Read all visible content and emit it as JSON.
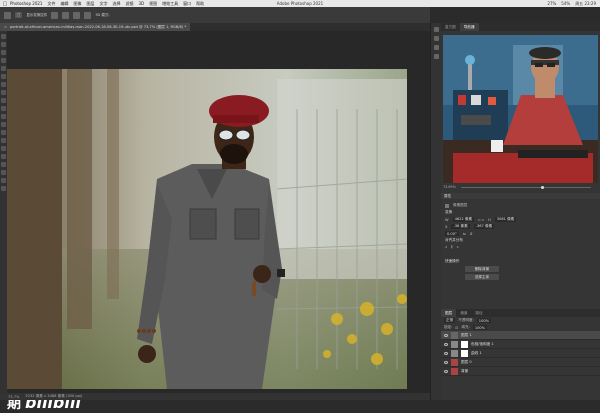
{
  "menubar": {
    "apple": "",
    "items": [
      "Photoshop 2021",
      "文件",
      "编辑",
      "图像",
      "图层",
      "文字",
      "选择",
      "滤镜",
      "3D",
      "视图",
      "增效工具",
      "窗口",
      "帮助"
    ],
    "app_title": "Adobe Photoshop 2021",
    "status": [
      "27%",
      "54%",
      "周五 23:29"
    ]
  },
  "options": {
    "btn1": "□",
    "label1": "显示变换控件",
    "label2": "3D 模式:"
  },
  "document_tab": {
    "close": "×",
    "title": "portrait-of-african-american-militias-man-2022-06-18-06-30-19-utc.psd @ 73.7% (图层 1, RGB/8) *"
  },
  "status_bar": {
    "zoom": "73.7%",
    "info": "5232 像素 x 3488 像素 (300 ppi)"
  },
  "watermark": {
    "prefix": "期",
    "logo": "bilibili"
  },
  "right_panel": {
    "tabs": [
      "图层",
      "通道",
      "路径"
    ],
    "top_tabs": [
      "直方图",
      "导航器"
    ],
    "zoom": "73.69%",
    "properties": {
      "header": "属性",
      "kind": "像素图层",
      "transform_title": "变换",
      "w_label": "W",
      "w_value": "4622 像素",
      "h_label": "H",
      "h_value": "3081 像素",
      "x_label": "X",
      "x_value": "-38 像素",
      "y_value": "-367 像素",
      "angle_value": "0.00°",
      "align_title": "对齐并分布",
      "quick_actions": "快速操作",
      "btn_remove_bg": "删除背景",
      "btn_select_subject": "选择主体"
    },
    "layers": {
      "blend_mode": "正常",
      "opacity_label": "不透明度:",
      "opacity": "100%",
      "fill_label": "填充:",
      "fill": "100%",
      "lock_label": "锁定:",
      "rows": [
        {
          "name": "图层 1"
        },
        {
          "name": "色相/饱和度 1"
        },
        {
          "name": "曲线 1"
        },
        {
          "name": "图层 0"
        },
        {
          "name": "背景"
        }
      ]
    }
  }
}
